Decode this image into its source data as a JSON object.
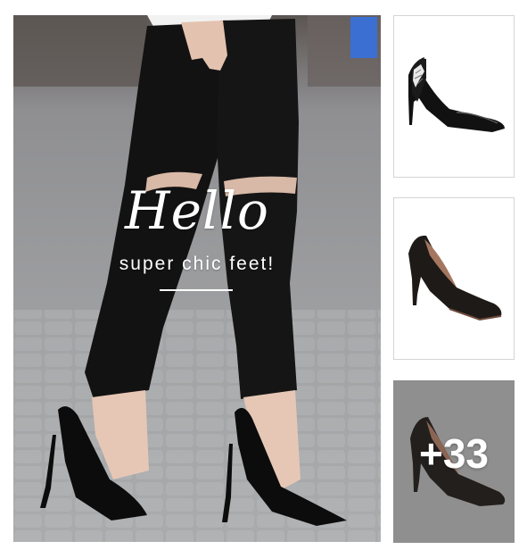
{
  "hero": {
    "title": "Hello",
    "subtitle": "super chic feet!"
  },
  "thumbnails": [
    {
      "subject": "black patent pump with white floral heel"
    },
    {
      "subject": "black leather pump"
    },
    {
      "subject": "black pump"
    }
  ],
  "more": {
    "label": "+33"
  },
  "colors": {
    "overlay": "#8f8f8f",
    "text": "#ffffff"
  }
}
